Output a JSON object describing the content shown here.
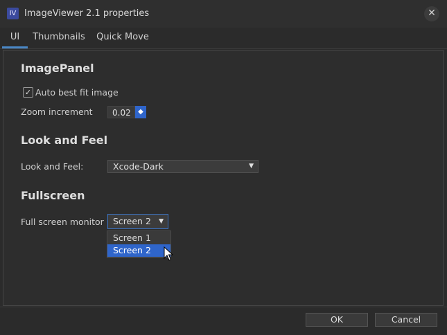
{
  "window": {
    "title": "ImageViewer 2.1 properties",
    "icon_text": "IV",
    "close_glyph": "✕"
  },
  "tabs": [
    {
      "label": "UI",
      "active": true
    },
    {
      "label": "Thumbnails",
      "active": false
    },
    {
      "label": "Quick Move",
      "active": false
    }
  ],
  "image_panel": {
    "heading": "ImagePanel",
    "auto_fit_label": "Auto best fit image",
    "auto_fit_checked": true,
    "zoom_label": "Zoom increment",
    "zoom_value": "0.02"
  },
  "look_and_feel": {
    "heading": "Look and Feel",
    "label": "Look and Feel:",
    "value": "Xcode-Dark"
  },
  "fullscreen": {
    "heading": "Fullscreen",
    "label": "Full screen monitor",
    "value": "Screen 2",
    "options": [
      "Screen 1",
      "Screen 2"
    ]
  },
  "buttons": {
    "ok": "OK",
    "cancel": "Cancel"
  },
  "colors": {
    "accent": "#2f65ca",
    "tab_underline": "#4a88c7",
    "background": "#2b2b2b"
  }
}
